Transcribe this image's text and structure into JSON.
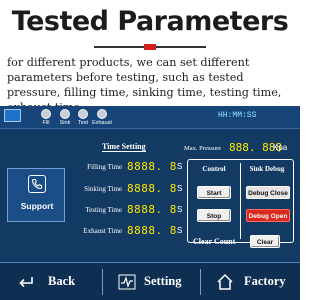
{
  "heading": {
    "title": "Tested Parameters",
    "description": "for different products, we can set different parameters before testing, such as tested pressure, filling time, sinking time, testing time, exhaust time."
  },
  "status_bar": {
    "indicators": [
      {
        "label": "Fill"
      },
      {
        "label": "Sink"
      },
      {
        "label": "Test"
      },
      {
        "label": "Exhaust"
      }
    ],
    "clock": "HH:MM:SS"
  },
  "support": {
    "label": "Support",
    "icon": "phone-icon"
  },
  "time_setting": {
    "heading": "Time Setting",
    "rows": [
      {
        "label": "Filling Time",
        "value": "8888. 8",
        "unit": "S"
      },
      {
        "label": "Sinking Time",
        "value": "8888. 8",
        "unit": "S"
      },
      {
        "label": "Testing Time",
        "value": "8888. 8",
        "unit": "S"
      },
      {
        "label": "Exhaust Time",
        "value": "8888. 8",
        "unit": "S"
      }
    ]
  },
  "max_pressure": {
    "label": "Max. Pressure",
    "value": "888. 888",
    "unit": "Kpa"
  },
  "control": {
    "heading": "Control",
    "start": "Start",
    "stop": "Stop"
  },
  "sink_debug": {
    "heading": "Sink Debug",
    "close": "Debug Close",
    "open": "Debug Open"
  },
  "clear_count": {
    "label": "Clear Count",
    "button": "Clear"
  },
  "nav": {
    "back": "Back",
    "setting": "Setting",
    "factory": "Factory"
  },
  "colors": {
    "screen_bg": "#123a63",
    "digits": "#ffe600",
    "accent_red": "#d41f1f"
  }
}
